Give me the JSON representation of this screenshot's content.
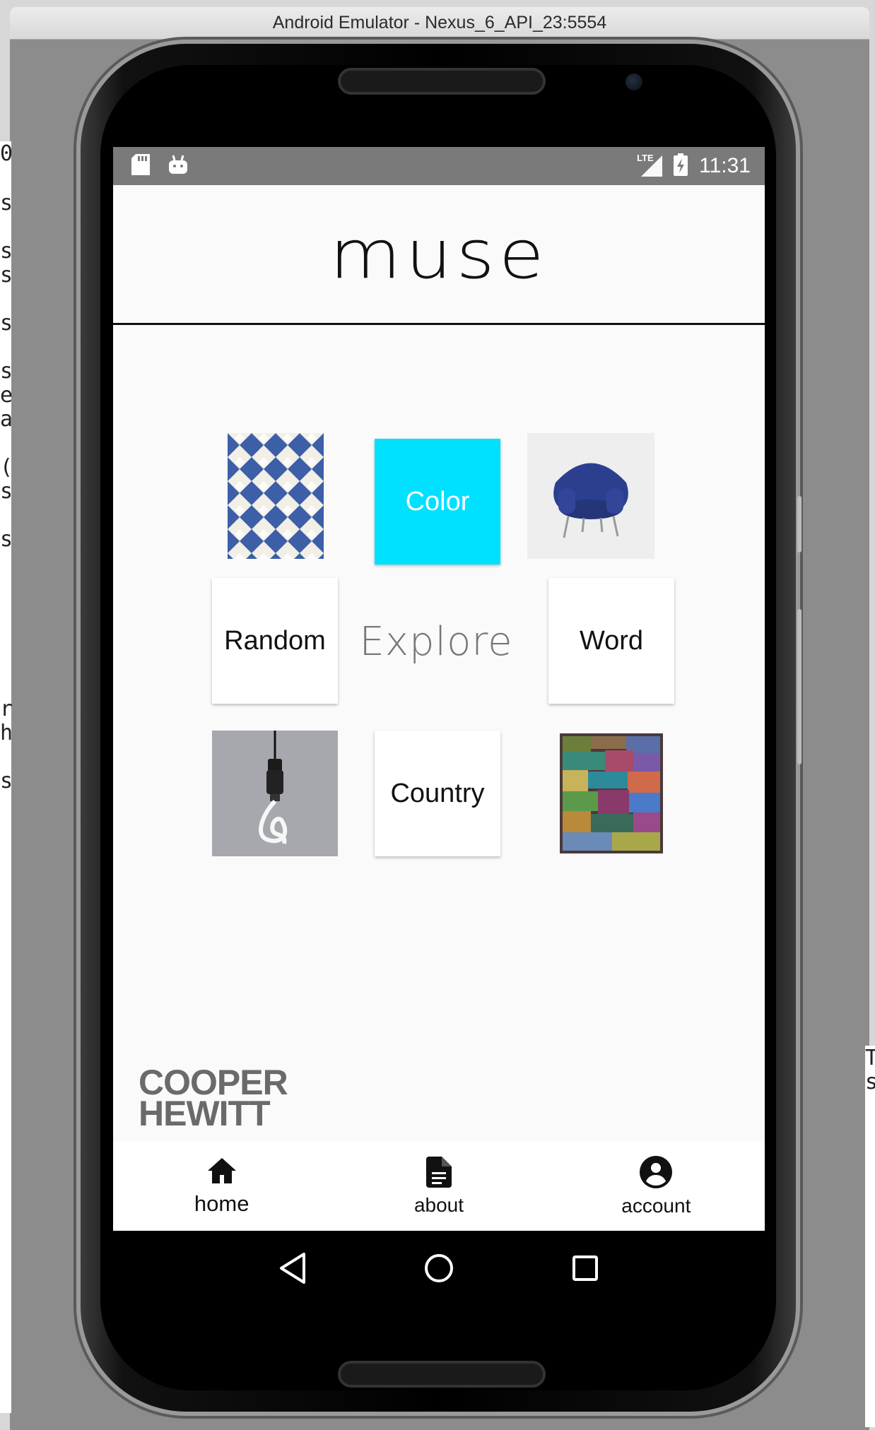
{
  "window": {
    "title": "Android Emulator - Nexus_6_API_23:5554"
  },
  "status_bar": {
    "network": "LTE",
    "time": "11:31"
  },
  "app": {
    "logo": "muse",
    "explore_label": "Explore",
    "tiles": {
      "color": "Color",
      "random": "Random",
      "word": "Word",
      "country": "Country"
    },
    "footer_brand": {
      "line1": "COOPER",
      "line2": "HEWITT"
    },
    "accent_color": "#00e0ff"
  },
  "bottom_nav": {
    "items": [
      {
        "label": "home",
        "icon": "home-icon"
      },
      {
        "label": "about",
        "icon": "document-icon"
      },
      {
        "label": "account",
        "icon": "account-circle-icon"
      }
    ]
  },
  "system_nav": {
    "icons": [
      "back-icon",
      "home-circle-icon",
      "recents-icon"
    ]
  },
  "background_glyphs_left": [
    "0",
    "s",
    "s",
    "s",
    "s",
    "s",
    "e",
    "a",
    "(",
    "s",
    "s",
    "r",
    "h",
    "s"
  ],
  "background_glyphs_right": [
    "T",
    "s"
  ]
}
